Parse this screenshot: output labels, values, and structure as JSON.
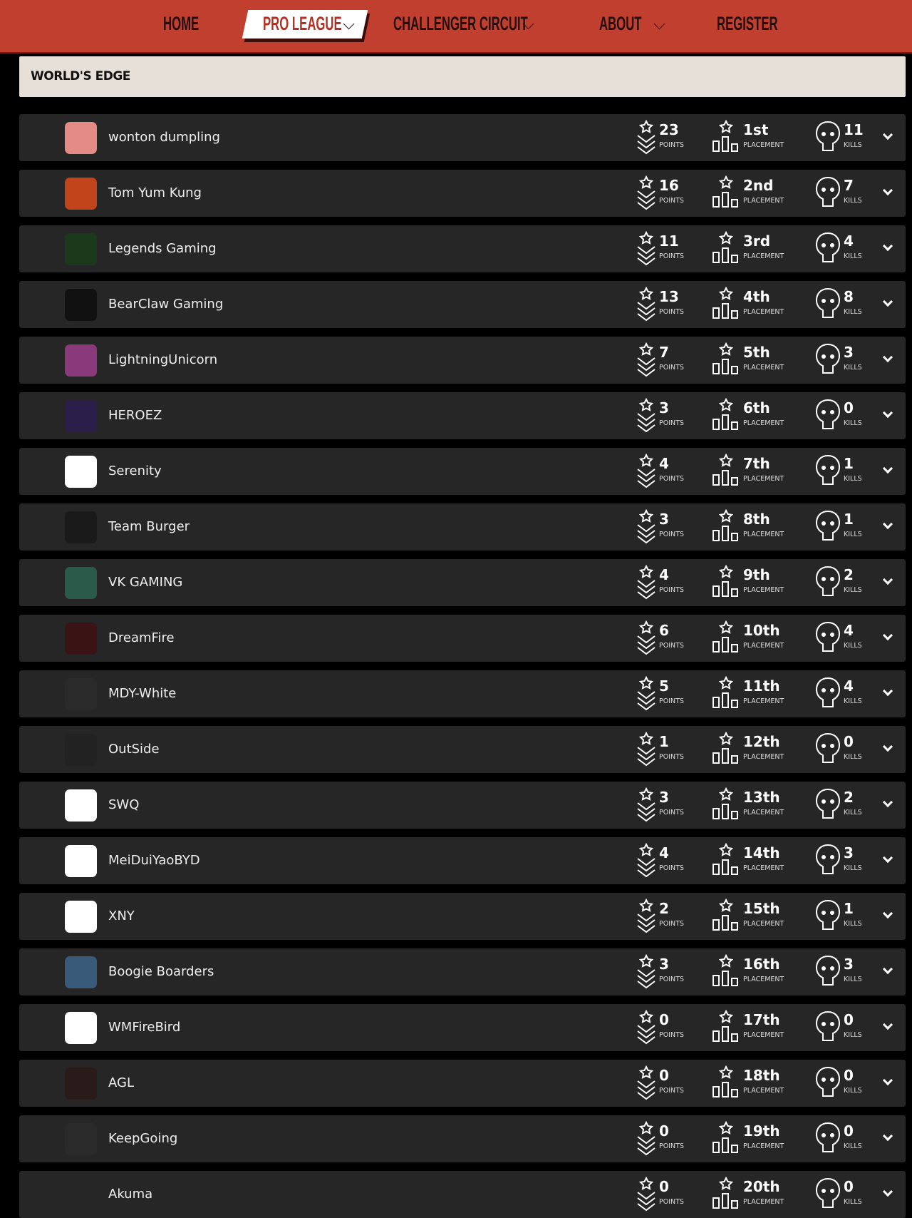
{
  "nav": {
    "items": [
      {
        "label": "HOME"
      },
      {
        "label": "PRO LEAGUE",
        "active": true,
        "dropdown": true
      },
      {
        "label": "CHALLENGER CIRCUIT",
        "dropdown": true
      },
      {
        "label": "ABOUT",
        "dropdown": true
      },
      {
        "label": "REGISTER"
      }
    ]
  },
  "section": {
    "title": "WORLD'S EDGE"
  },
  "labels": {
    "points": "POINTS",
    "placement": "PLACEMENT",
    "kills": "KILLS"
  },
  "colors": {
    "nav_bg": "#c13f2f",
    "row_bg": "#262626",
    "header_bg": "#e7e0d8"
  },
  "teams": [
    {
      "name": "wonton dumpling",
      "points": "23",
      "placement": "1st",
      "kills": "11",
      "logo_bg": "#e58b86"
    },
    {
      "name": "Tom Yum Kung",
      "points": "16",
      "placement": "2nd",
      "kills": "7",
      "logo_bg": "#c2441b"
    },
    {
      "name": "Legends Gaming",
      "points": "11",
      "placement": "3rd",
      "kills": "4",
      "logo_bg": "#1b3a1b"
    },
    {
      "name": "BearClaw Gaming",
      "points": "13",
      "placement": "4th",
      "kills": "8",
      "logo_bg": "#111111"
    },
    {
      "name": "LightningUnicorn",
      "points": "7",
      "placement": "5th",
      "kills": "3",
      "logo_bg": "#8a3a7a"
    },
    {
      "name": "HEROEZ",
      "points": "3",
      "placement": "6th",
      "kills": "0",
      "logo_bg": "#2a1f4a"
    },
    {
      "name": "Serenity",
      "points": "4",
      "placement": "7th",
      "kills": "1",
      "logo_bg": "#ffffff"
    },
    {
      "name": "Team Burger",
      "points": "3",
      "placement": "8th",
      "kills": "1",
      "logo_bg": "#1a1a1a"
    },
    {
      "name": "VK GAMING",
      "points": "4",
      "placement": "9th",
      "kills": "2",
      "logo_bg": "#2a5a4a"
    },
    {
      "name": "DreamFire",
      "points": "6",
      "placement": "10th",
      "kills": "4",
      "logo_bg": "#3a1414"
    },
    {
      "name": "MDY-White",
      "points": "5",
      "placement": "11th",
      "kills": "4",
      "logo_bg": "#2a2a2a"
    },
    {
      "name": "OutSide",
      "points": "1",
      "placement": "12th",
      "kills": "0",
      "logo_bg": "#222222"
    },
    {
      "name": "SWQ",
      "points": "3",
      "placement": "13th",
      "kills": "2",
      "logo_bg": "#ffffff"
    },
    {
      "name": "MeiDuiYaoBYD",
      "points": "4",
      "placement": "14th",
      "kills": "3",
      "logo_bg": "#ffffff"
    },
    {
      "name": "XNY",
      "points": "2",
      "placement": "15th",
      "kills": "1",
      "logo_bg": "#ffffff"
    },
    {
      "name": "Boogie Boarders",
      "points": "3",
      "placement": "16th",
      "kills": "3",
      "logo_bg": "#3a5a7a"
    },
    {
      "name": "WMFireBird",
      "points": "0",
      "placement": "17th",
      "kills": "0",
      "logo_bg": "#ffffff"
    },
    {
      "name": "AGL",
      "points": "0",
      "placement": "18th",
      "kills": "0",
      "logo_bg": "#2a1a1a"
    },
    {
      "name": "KeepGoing",
      "points": "0",
      "placement": "19th",
      "kills": "0",
      "logo_bg": "#2a2a2a"
    },
    {
      "name": "Akuma",
      "points": "0",
      "placement": "20th",
      "kills": "0",
      "logo_bg": "#262626"
    }
  ]
}
